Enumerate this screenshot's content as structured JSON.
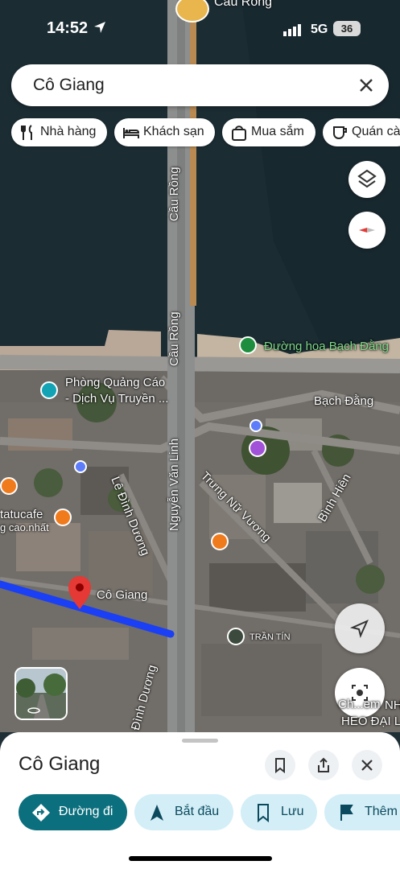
{
  "status_bar": {
    "time": "14:52",
    "network": "5G",
    "battery": "36"
  },
  "top_place": "Cầu Rồng",
  "search": {
    "value": "Cô Giang"
  },
  "chips": [
    {
      "label": "Nhà hàng",
      "icon": "restaurant-icon"
    },
    {
      "label": "Khách sạn",
      "icon": "bed-icon"
    },
    {
      "label": "Mua sắm",
      "icon": "shopping-bag-icon"
    },
    {
      "label": "Quán cà",
      "icon": "coffee-icon"
    }
  ],
  "map_labels": {
    "bridge_1": "Cầu Rồng",
    "bridge_2": "Cầu Rồng",
    "park": "Đường hoa Bạch Đằng",
    "ad_1": "Phòng Quảng Cáo",
    "ad_2": "- Dịch Vụ Truyền ...",
    "bach_dang": "Bạch Đằng",
    "cafe": "tatucafe",
    "cafe_sub": "g cao.nhất",
    "le_dinh_duong": "Lê Đình Dương",
    "nguyen_van_linh": "Nguyễn Văn Linh",
    "trung_nu_vuong": "Trưng Nữ Vương",
    "binh_hien": "Bình Hiên",
    "co_giang": "Cô Giang",
    "tran_tin": "TRẦN TÍN",
    "dinh_duong": "Đình Dương",
    "heo": "HEO ĐẠI L",
    "nh": "NH",
    "che": "Ch...em"
  },
  "sheet": {
    "title": "Cô Giang",
    "actions": [
      {
        "label": "Đường đi",
        "icon": "directions-icon"
      },
      {
        "label": "Bắt đầu",
        "icon": "navigation-icon"
      },
      {
        "label": "Lưu",
        "icon": "bookmark-icon"
      },
      {
        "label": "Thêm",
        "icon": "flag-icon"
      }
    ]
  },
  "colors": {
    "route": "#1a3ff5",
    "pin": "#e53935",
    "primary": "#0b6f7d"
  }
}
